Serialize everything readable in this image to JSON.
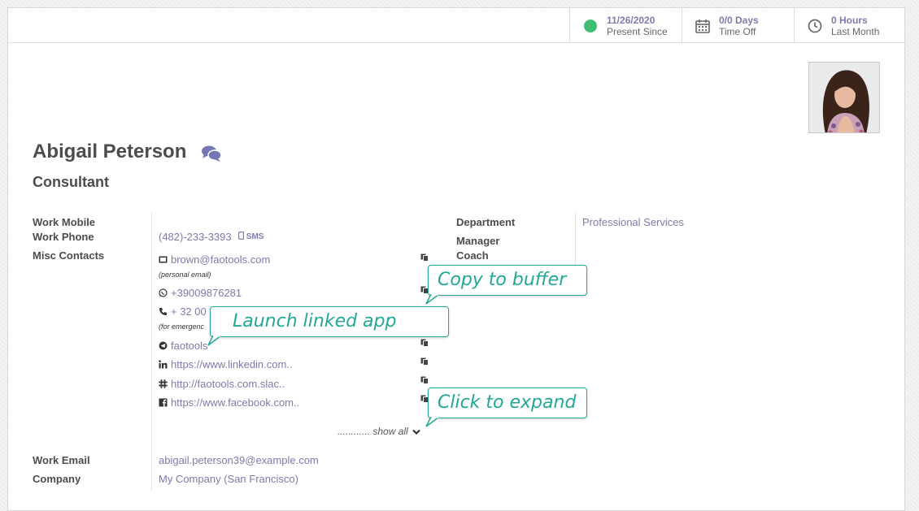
{
  "stats": {
    "presence": {
      "value": "11/26/2020",
      "label": "Present Since",
      "status_color": "#3dbf73"
    },
    "time_off": {
      "value": "0/0 Days",
      "label": "Time Off",
      "icon": "calendar-icon"
    },
    "hours": {
      "value": "0 Hours",
      "label": "Last Month",
      "icon": "clock-icon"
    }
  },
  "employee": {
    "name": "Abigail Peterson",
    "job_title": "Consultant",
    "chat_icon": "chat-bubbles-icon"
  },
  "fields": {
    "work_mobile_label": "Work Mobile",
    "work_phone_label": "Work Phone",
    "work_phone_value": "(482)-233-3393",
    "sms_label": "SMS",
    "misc_contacts_label": "Misc Contacts",
    "work_email_label": "Work Email",
    "work_email_value": "abigail.peterson39@example.com",
    "company_label": "Company",
    "company_value": "My Company (San Francisco)",
    "department_label": "Department",
    "department_value": "Professional Services",
    "manager_label": "Manager",
    "coach_label": "Coach"
  },
  "contacts": [
    {
      "icon": "envelope-icon",
      "value": "brown@faotools.com",
      "note": "(personal email)"
    },
    {
      "icon": "whatsapp-icon",
      "value": "+39009876281"
    },
    {
      "icon": "phone-icon",
      "value": "+ 32 00 3",
      "note": "(for emergenc"
    },
    {
      "icon": "telegram-icon",
      "value": "faotools"
    },
    {
      "icon": "linkedin-icon",
      "value": "https://www.linkedin.com.."
    },
    {
      "icon": "slack-icon",
      "value": "http://faotools.com.slac.."
    },
    {
      "icon": "facebook-icon",
      "value": "https://www.facebook.com.."
    }
  ],
  "show_all": "............ show all",
  "callouts": {
    "copy": "Copy to buffer",
    "launch": "Launch linked app",
    "expand": "Click to expand"
  },
  "colors": {
    "accent": "#7c7bad",
    "callout": "#21a896"
  }
}
